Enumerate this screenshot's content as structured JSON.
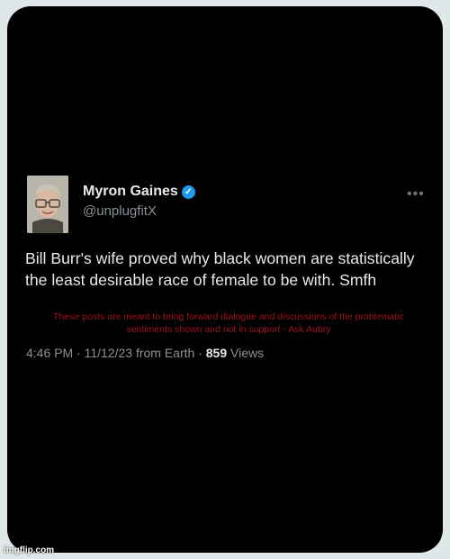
{
  "tweet": {
    "display_name": "Myron Gaines",
    "handle": "@unplugfitX",
    "text": "Bill Burr's wife proved why black women are statistically the least desirable race of female to be with. Smfh",
    "time": "4:46 PM",
    "date": "11/12/23",
    "source": "from Earth",
    "views_count": "859",
    "views_label": "Views",
    "more_icon": "more-horizontal-icon",
    "verified_icon": "verified-badge-icon",
    "verified_color": "#1d9bf0"
  },
  "overlay": {
    "disclaimer": "These posts are meant to bring forward dialogue and discussions of the problematic sentiments shown and not in support - Ask Aubry",
    "disclaimer_color": "#9e1220"
  },
  "watermark": {
    "text": "imgflip.com"
  },
  "colors": {
    "background": "#000000",
    "frame": "#dfe7e8",
    "text_primary": "#e9e9e9",
    "text_secondary": "#8a9196"
  }
}
